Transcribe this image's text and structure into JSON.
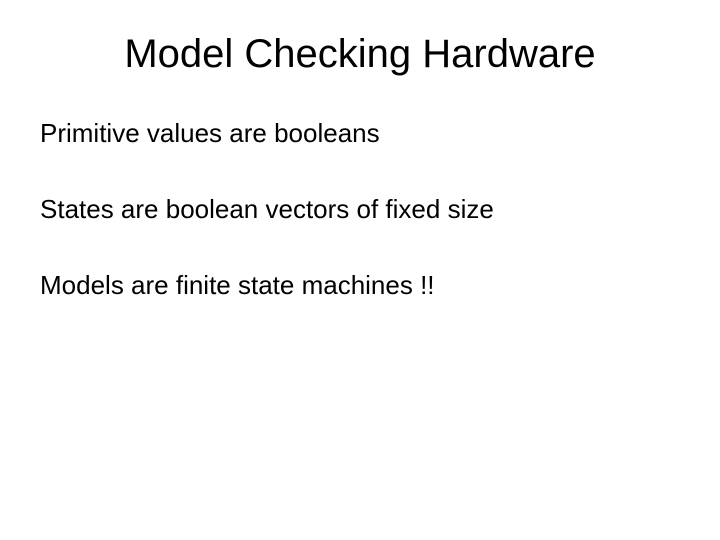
{
  "slide": {
    "title": "Model Checking Hardware",
    "lines": [
      "Primitive values are booleans",
      "States are boolean vectors of fixed size",
      "Models are finite state machines !!"
    ]
  }
}
